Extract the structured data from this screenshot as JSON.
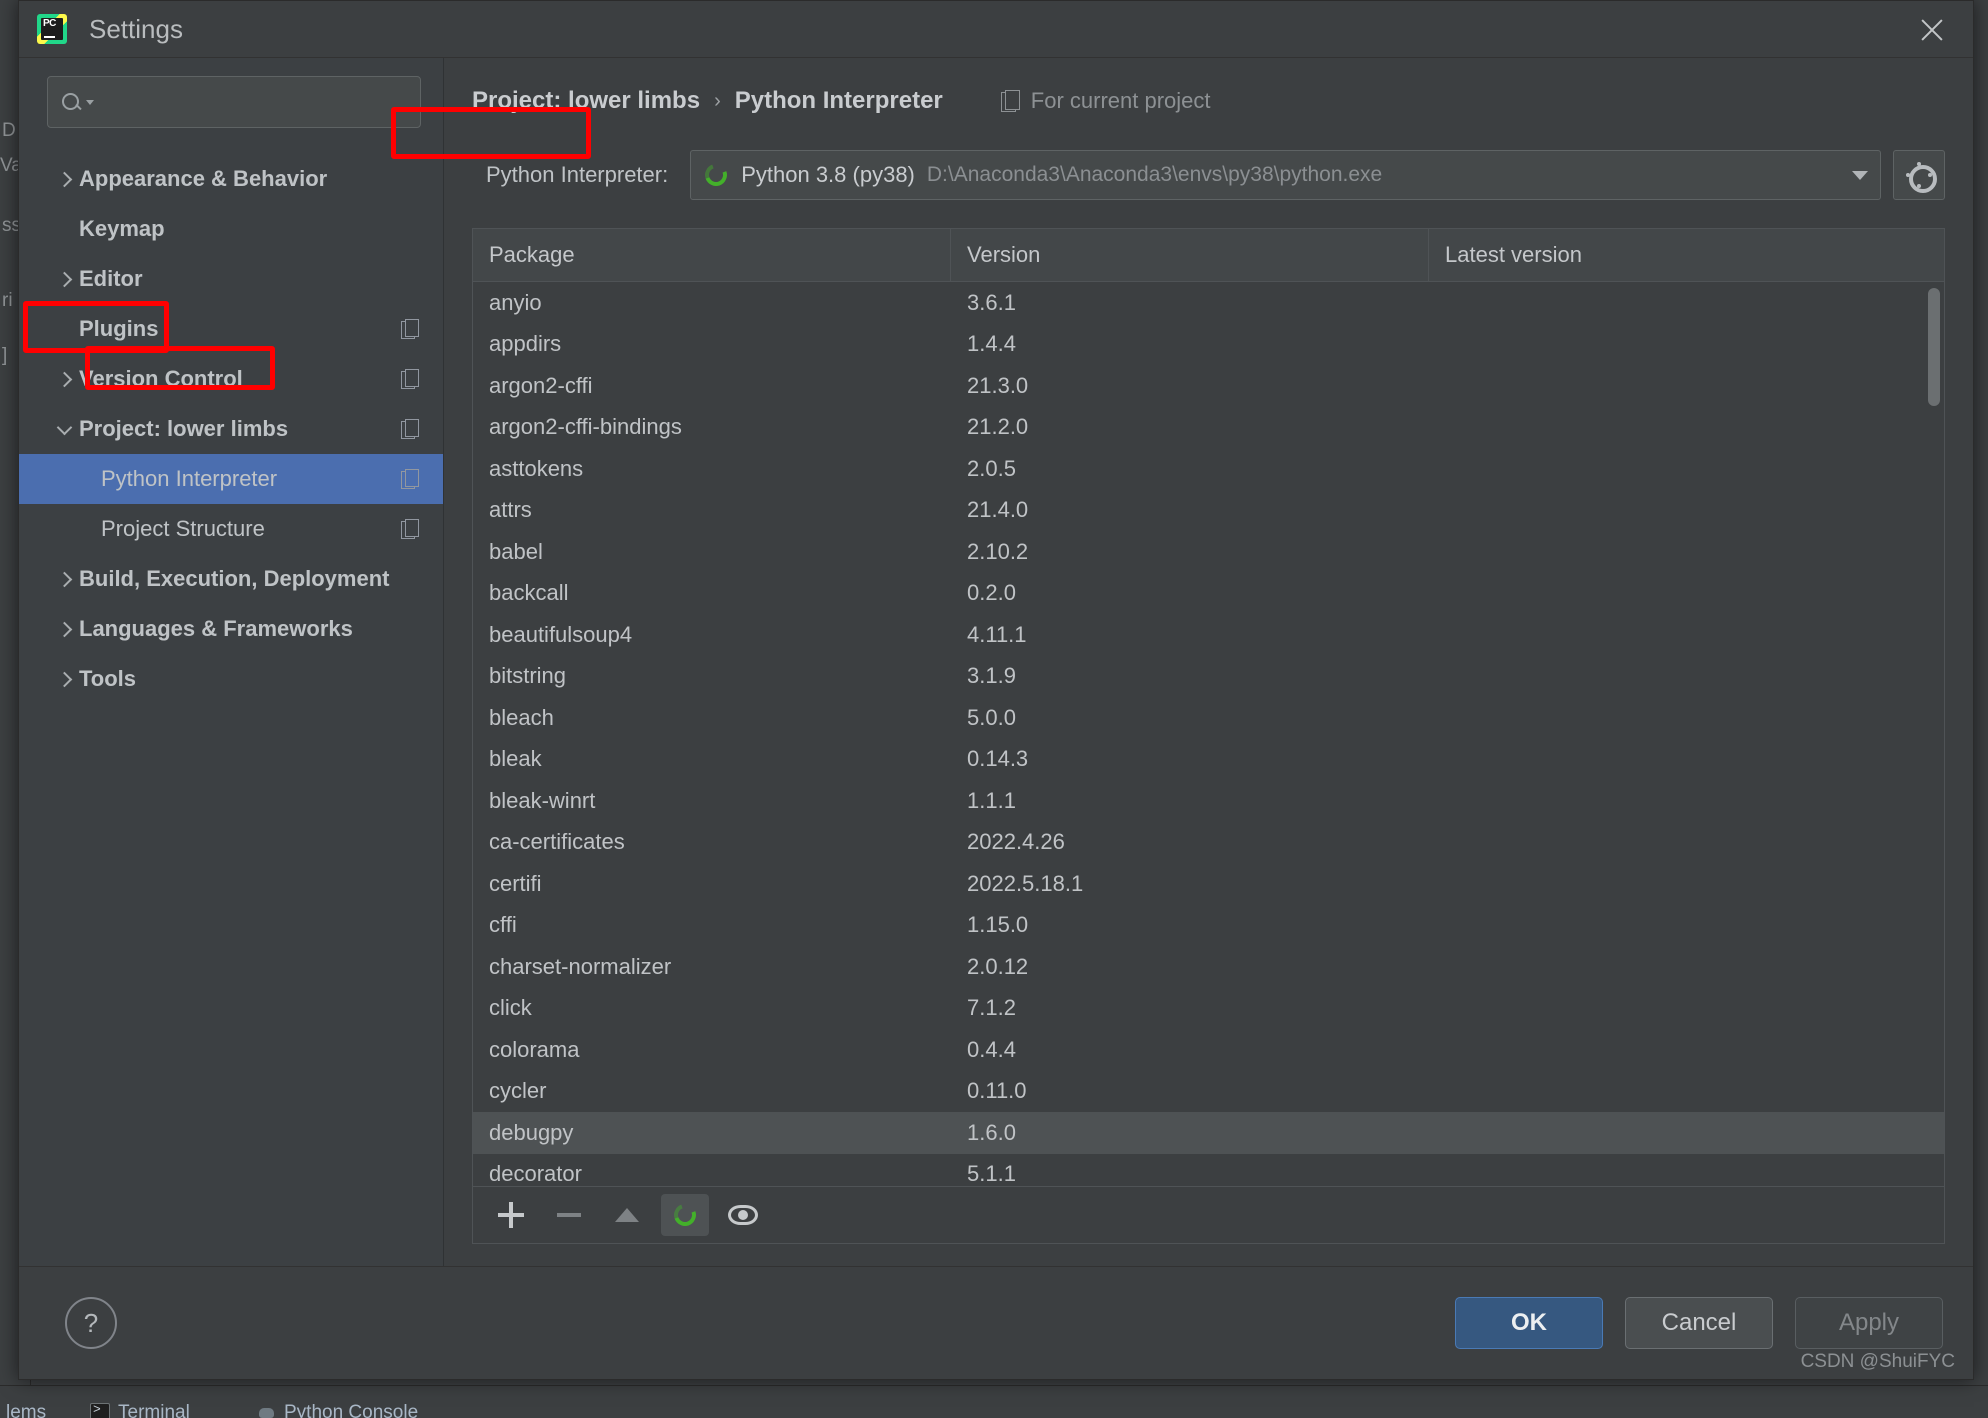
{
  "window": {
    "title": "Settings",
    "logo_text": "PC",
    "close_icon": "close-icon"
  },
  "sidebar": {
    "search_placeholder": "",
    "search_value": "",
    "items": [
      {
        "label": "Appearance & Behavior",
        "arrow": "collapsed",
        "bold": true,
        "child": false,
        "badge": false,
        "selected": false
      },
      {
        "label": "Keymap",
        "arrow": "none",
        "bold": true,
        "child": false,
        "badge": false,
        "selected": false
      },
      {
        "label": "Editor",
        "arrow": "collapsed",
        "bold": true,
        "child": false,
        "badge": false,
        "selected": false
      },
      {
        "label": "Plugins",
        "arrow": "none",
        "bold": true,
        "child": false,
        "badge": true,
        "selected": false
      },
      {
        "label": "Version Control",
        "arrow": "collapsed",
        "bold": true,
        "child": false,
        "badge": true,
        "selected": false
      },
      {
        "label": "Project: lower limbs",
        "arrow": "expanded",
        "bold": true,
        "child": false,
        "badge": true,
        "selected": false
      },
      {
        "label": "Python Interpreter",
        "arrow": "none",
        "bold": false,
        "child": true,
        "badge": true,
        "selected": true
      },
      {
        "label": "Project Structure",
        "arrow": "none",
        "bold": false,
        "child": true,
        "badge": true,
        "selected": false
      },
      {
        "label": "Build, Execution, Deployment",
        "arrow": "collapsed",
        "bold": true,
        "child": false,
        "badge": false,
        "selected": false
      },
      {
        "label": "Languages & Frameworks",
        "arrow": "collapsed",
        "bold": true,
        "child": false,
        "badge": false,
        "selected": false
      },
      {
        "label": "Tools",
        "arrow": "collapsed",
        "bold": true,
        "child": false,
        "badge": false,
        "selected": false
      }
    ]
  },
  "breadcrumb": {
    "root": "Project: lower limbs",
    "separator": "›",
    "leaf": "Python Interpreter",
    "scope_label": "For current project",
    "scope_icon": "copy-icon"
  },
  "interpreter": {
    "label": "Python Interpreter:",
    "icon": "conda-env-icon",
    "name": "Python 3.8 (py38)",
    "path": "D:\\Anaconda3\\Anaconda3\\envs\\py38\\python.exe",
    "dropdown_icon": "chevron-down-icon",
    "gear_icon": "gear-icon"
  },
  "packages_table": {
    "columns": [
      "Package",
      "Version",
      "Latest version"
    ],
    "rows": [
      {
        "package": "anyio",
        "version": "3.6.1",
        "latest": ""
      },
      {
        "package": "appdirs",
        "version": "1.4.4",
        "latest": ""
      },
      {
        "package": "argon2-cffi",
        "version": "21.3.0",
        "latest": ""
      },
      {
        "package": "argon2-cffi-bindings",
        "version": "21.2.0",
        "latest": ""
      },
      {
        "package": "asttokens",
        "version": "2.0.5",
        "latest": ""
      },
      {
        "package": "attrs",
        "version": "21.4.0",
        "latest": ""
      },
      {
        "package": "babel",
        "version": "2.10.2",
        "latest": ""
      },
      {
        "package": "backcall",
        "version": "0.2.0",
        "latest": ""
      },
      {
        "package": "beautifulsoup4",
        "version": "4.11.1",
        "latest": ""
      },
      {
        "package": "bitstring",
        "version": "3.1.9",
        "latest": ""
      },
      {
        "package": "bleach",
        "version": "5.0.0",
        "latest": ""
      },
      {
        "package": "bleak",
        "version": "0.14.3",
        "latest": ""
      },
      {
        "package": "bleak-winrt",
        "version": "1.1.1",
        "latest": ""
      },
      {
        "package": "ca-certificates",
        "version": "2022.4.26",
        "latest": ""
      },
      {
        "package": "certifi",
        "version": "2022.5.18.1",
        "latest": ""
      },
      {
        "package": "cffi",
        "version": "1.15.0",
        "latest": ""
      },
      {
        "package": "charset-normalizer",
        "version": "2.0.12",
        "latest": ""
      },
      {
        "package": "click",
        "version": "7.1.2",
        "latest": ""
      },
      {
        "package": "colorama",
        "version": "0.4.4",
        "latest": ""
      },
      {
        "package": "cycler",
        "version": "0.11.0",
        "latest": ""
      },
      {
        "package": "debugpy",
        "version": "1.6.0",
        "latest": "",
        "hovered": true
      },
      {
        "package": "decorator",
        "version": "5.1.1",
        "latest": ""
      }
    ],
    "toolbar": [
      {
        "name": "add-package-button",
        "icon": "plus-icon",
        "active": false
      },
      {
        "name": "remove-package-button",
        "icon": "minus-icon",
        "active": false
      },
      {
        "name": "upgrade-package-button",
        "icon": "arrow-up-icon",
        "active": false
      },
      {
        "name": "conda-refresh-button",
        "icon": "conda-icon",
        "active": true
      },
      {
        "name": "show-early-releases-button",
        "icon": "eye-icon",
        "active": false
      }
    ]
  },
  "footer": {
    "help_label": "?",
    "ok_label": "OK",
    "cancel_label": "Cancel",
    "apply_label": "Apply",
    "watermark": "CSDN @ShuiFYC"
  },
  "backdrop": {
    "glyphs": [
      "D",
      "Va",
      "ss",
      "ri",
      "]"
    ],
    "taskbar": [
      {
        "label": "lems",
        "icon": "none"
      },
      {
        "label": "Terminal",
        "icon": "terminal"
      },
      {
        "label": "Python Console",
        "icon": "pyconsole"
      }
    ]
  },
  "colors": {
    "accent": "#4b6eaf",
    "ok_button": "#365880",
    "annotation": "#ff0000",
    "conda_green": "#43b02a"
  }
}
